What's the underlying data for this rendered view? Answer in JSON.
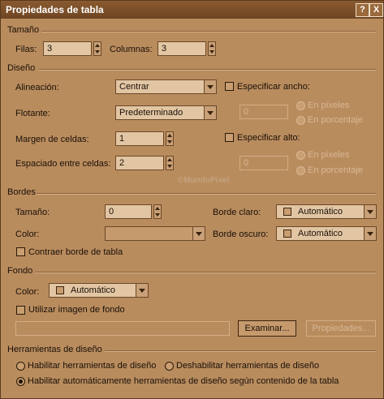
{
  "window": {
    "title": "Propiedades de tabla",
    "help_label": "?",
    "close_label": "X"
  },
  "size": {
    "section": "Tamaño",
    "rows_label": "Filas:",
    "rows_value": "3",
    "cols_label": "Columnas:",
    "cols_value": "3"
  },
  "layout": {
    "section": "Diseño",
    "align_label": "Alineación:",
    "align_value": "Centrar",
    "float_label": "Flotante:",
    "float_value": "Predeterminado",
    "padding_label": "Margen de celdas:",
    "padding_value": "1",
    "spacing_label": "Espaciado entre celdas:",
    "spacing_value": "2",
    "width_check": "Especificar ancho:",
    "width_value": "0",
    "width_pixels": "En píxeles",
    "width_percent": "En porcentaje",
    "height_check": "Especificar alto:",
    "height_value": "0",
    "height_pixels": "En píxeles",
    "height_percent": "En porcentaje",
    "watermark": "©MundoPixel"
  },
  "borders": {
    "section": "Bordes",
    "size_label": "Tamaño:",
    "size_value": "0",
    "color_label": "Color:",
    "light_label": "Borde claro:",
    "light_value": "Automático",
    "dark_label": "Borde oscuro:",
    "dark_value": "Automático",
    "collapse_label": "Contraer borde de tabla"
  },
  "background": {
    "section": "Fondo",
    "color_label": "Color:",
    "color_value": "Automático",
    "image_label": "Utilizar imagen de fondo",
    "browse_label": "Examinar...",
    "props_label": "Propiedades..."
  },
  "tools": {
    "section": "Herramientas de diseño",
    "enable_label": "Habilitar herramientas de diseño",
    "disable_label": "Deshabilitar herramientas de diseño",
    "auto_label": "Habilitar automáticamente herramientas de diseño según contenido de la tabla"
  }
}
